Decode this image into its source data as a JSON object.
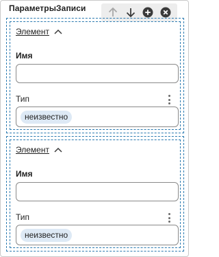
{
  "panel": {
    "title": "ПараметрыЗаписи"
  },
  "toolbar": {
    "icons": [
      "arrow-up-icon",
      "arrow-down-icon",
      "add-circle-icon",
      "remove-circle-icon"
    ]
  },
  "records": [
    {
      "header_link": "Элемент",
      "name_label": "Имя",
      "name_value": "",
      "type_label": "Тип",
      "type_value": "неизвестно"
    },
    {
      "header_link": "Элемент",
      "name_label": "Имя",
      "name_value": "",
      "type_label": "Тип",
      "type_value": "неизвестно"
    }
  ],
  "colors": {
    "dash_border": "#2a7ab0",
    "chip_bg": "#dde9f5",
    "toolbar_bg": "#ededed"
  }
}
